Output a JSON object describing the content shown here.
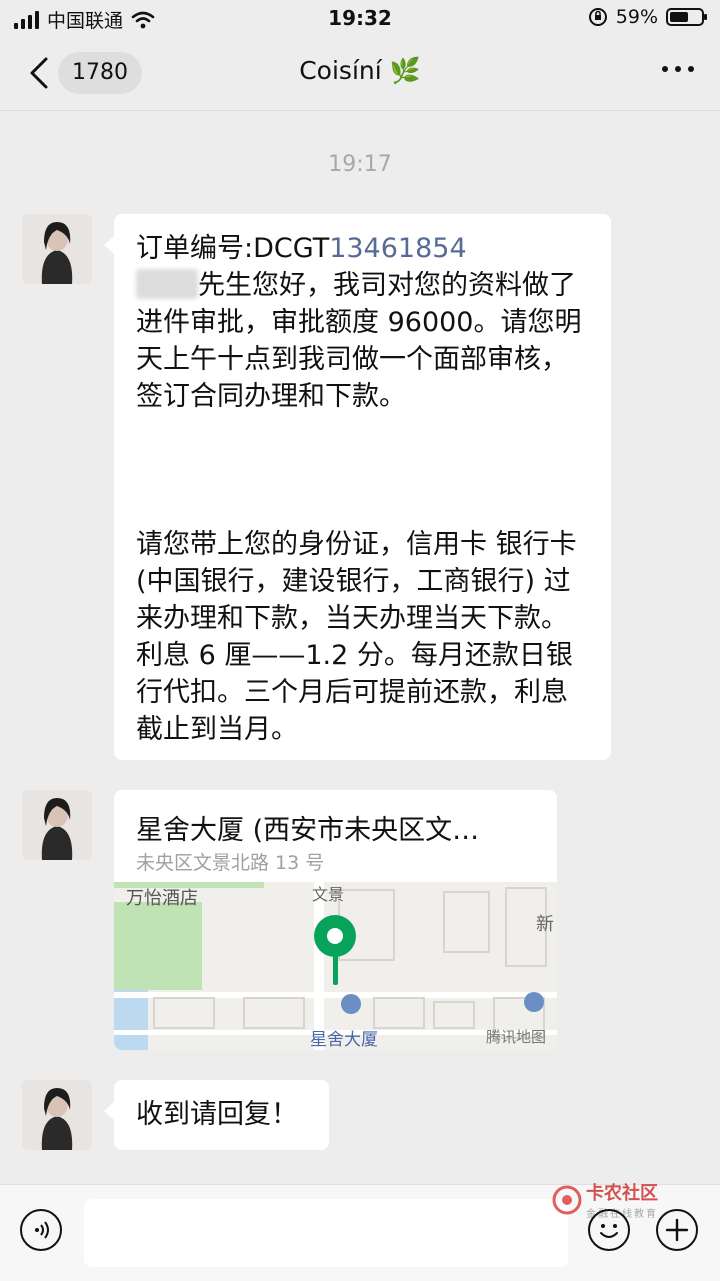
{
  "status_bar": {
    "carrier": "中国联通",
    "time": "19:32",
    "battery": "59%",
    "battery_level": 0.59
  },
  "header": {
    "unread_count": "1780",
    "title": "Coisíní 🌿"
  },
  "timestamp": "19:17",
  "message1": {
    "order_label": "订单编号:DCGT",
    "order_number": "13461854",
    "para1_rest": "先生您好，我司对您的资料做了进件审批，审批额度 96000。请您明天上午十点到我司做一个面部审核，签订合同办理和下款。",
    "para2": "请您带上您的身份证，信用卡 银行卡 (中国银行，建设银行，工商银行) 过来办理和下款，当天办理当天下款。利息 6 厘——1.2 分。每月还款日银行代扣。三个月后可提前还款，利息截止到当月。"
  },
  "location": {
    "title": "星舍大厦 (西安市未央区文…",
    "address": "未央区文景北路 13 号",
    "map_labels": {
      "hotel": "万怡酒店",
      "road": "文景",
      "new": "新",
      "building": "星舍大厦",
      "provider": "腾讯地图"
    }
  },
  "message3": {
    "text": "收到请回复！"
  },
  "watermark": {
    "name": "卡农社区",
    "sub": "金融在线教育"
  },
  "colors": {
    "link": "#576b95",
    "pin": "#07a35a",
    "background": "#ededed"
  }
}
